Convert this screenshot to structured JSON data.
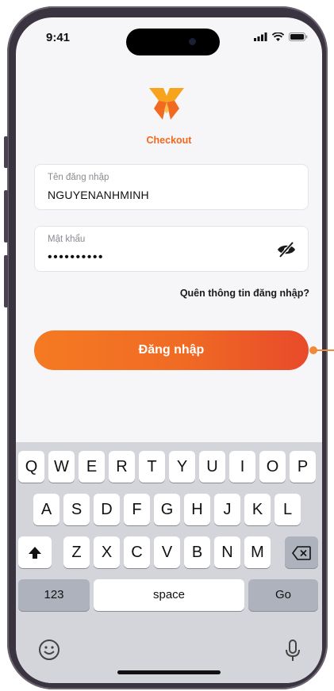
{
  "status_bar": {
    "time": "9:41"
  },
  "brand": {
    "name": "Checkout",
    "accent": "#F0681E"
  },
  "username": {
    "label": "Tên đăng nhập",
    "value": "NGUYENANHMINH"
  },
  "password": {
    "label": "Mật khẩu",
    "value": "••••••••••",
    "toggle_icon": "eye-off-icon"
  },
  "forgot_link": "Quên thông tin đăng nhập?",
  "login_button": "Đăng nhập",
  "keyboard": {
    "row1": [
      "Q",
      "W",
      "E",
      "R",
      "T",
      "Y",
      "U",
      "I",
      "O",
      "P"
    ],
    "row2": [
      "A",
      "S",
      "D",
      "F",
      "G",
      "H",
      "J",
      "K",
      "L"
    ],
    "row3": [
      "Z",
      "X",
      "C",
      "V",
      "B",
      "N",
      "M"
    ],
    "numbers_key": "123",
    "space_key": "space",
    "go_key": "Go",
    "shift_icon": "shift-icon",
    "delete_icon": "backspace-icon",
    "emoji_icon": "emoji-icon",
    "mic_icon": "microphone-icon"
  }
}
